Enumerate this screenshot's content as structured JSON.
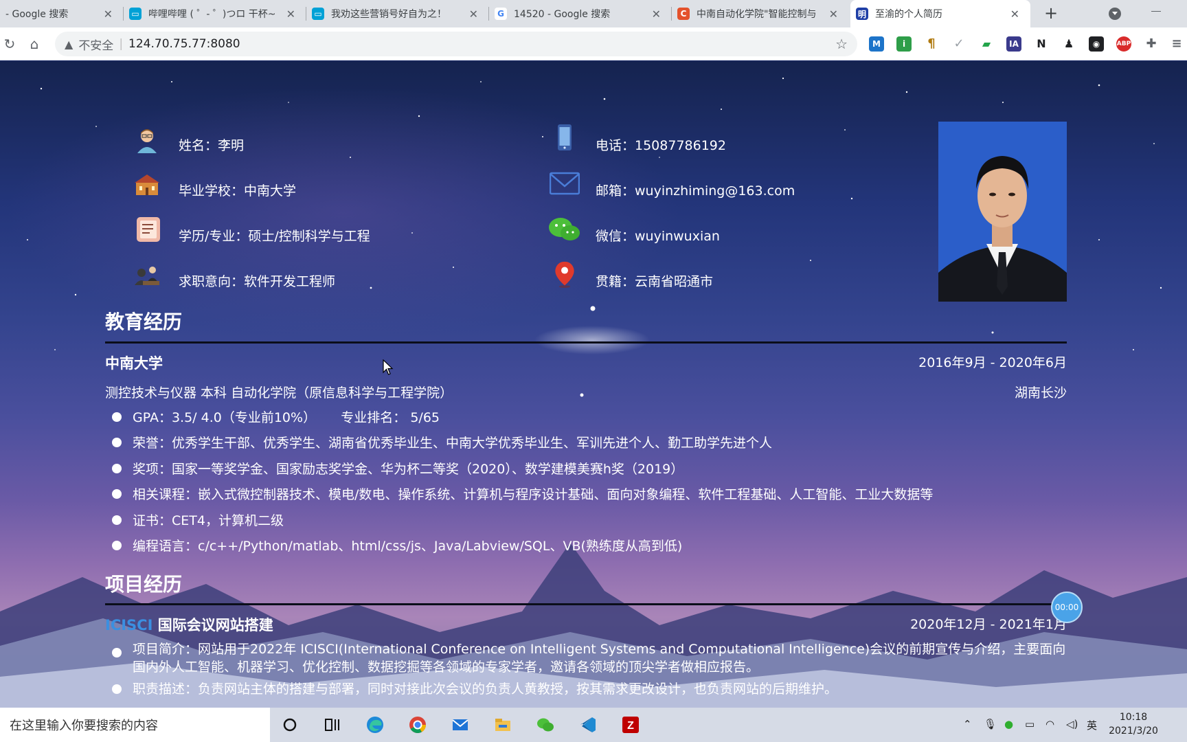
{
  "browser": {
    "tabs": [
      {
        "title": "- Google 搜索",
        "icon": "google-icon"
      },
      {
        "title": "哔哩哔哩 ( ゜- ゜)つロ 干杯~",
        "icon": "bilibili-icon"
      },
      {
        "title": "我劝这些营销号好自为之！",
        "icon": "bilibili-icon"
      },
      {
        "title": "14520 - Google 搜索",
        "icon": "google-icon"
      },
      {
        "title": "中南自动化学院\"智能控制与",
        "icon": "csdn-icon"
      },
      {
        "title": "至渝的个人简历",
        "icon": "ming-icon"
      }
    ],
    "new_tab": "+",
    "insecure_label": "不安全",
    "url": "124.70.75.77:8080"
  },
  "profile": {
    "name": "姓名：李明",
    "school": "毕业学校：中南大学",
    "degree": "学历/专业：硕士/控制科学与工程",
    "intention": "求职意向：软件开发工程师",
    "phone": "电话：15087786192",
    "email": "邮箱：wuyinzhiming@163.com",
    "wechat": "微信：wuyinwuxian",
    "hometown": "贯籍：云南省昭通市"
  },
  "education": {
    "title": "教育经历",
    "school": "中南大学",
    "dates": "2016年9月 - 2020年6月",
    "major": "测控技术与仪器 本科 自动化学院（原信息科学与工程学院）",
    "location": "湖南长沙",
    "items": [
      "GPA：3.5/ 4.0（专业前10%）      专业排名： 5/65",
      "荣誉：优秀学生干部、优秀学生、湖南省优秀毕业生、中南大学优秀毕业生、军训先进个人、勤工助学先进个人",
      "奖项：国家一等奖学金、国家励志奖学金、华为杯二等奖（2020）、数学建模美赛h奖（2019）",
      "相关课程：嵌入式微控制器技术、模电/数电、操作系统、计算机与程序设计基础、面向对象编程、软件工程基础、人工智能、工业大数据等",
      "证书：CET4，计算机二级",
      "编程语言：c/c++/Python/matlab、html/css/js、Java/Labview/SQL、VB(熟练度从高到低)"
    ]
  },
  "projects": {
    "title": "项目经历",
    "project_name_prefix": "ICISCI",
    "project_name": " 国际会议网站搭建",
    "dates": "2020年12月 - 2021年1月",
    "items": [
      "项目简介：网站用于2022年 ICISCI(International Conference on Intelligent Systems and Computational Intelligence)会议的前期宣传与介绍，主要面向国内外人工智能、机器学习、优化控制、数据挖掘等各领域的专家学者，邀请各领域的顶尖学者做相应报告。",
      "职责描述：负责网站主体的搭建与部署，同时对接此次会议的负责人黄教授，按其需求更改设计，也负责网站的后期维护。"
    ]
  },
  "overlay": {
    "timer": "00:00"
  },
  "taskbar": {
    "search_placeholder": "在这里输入你要搜索的内容",
    "ime": "英",
    "time": "10:18",
    "date": "2021/3/20"
  },
  "colors": {
    "accent": "#3b8fe0",
    "background_top": "#15234f",
    "background_bottom": "#a985b8"
  }
}
